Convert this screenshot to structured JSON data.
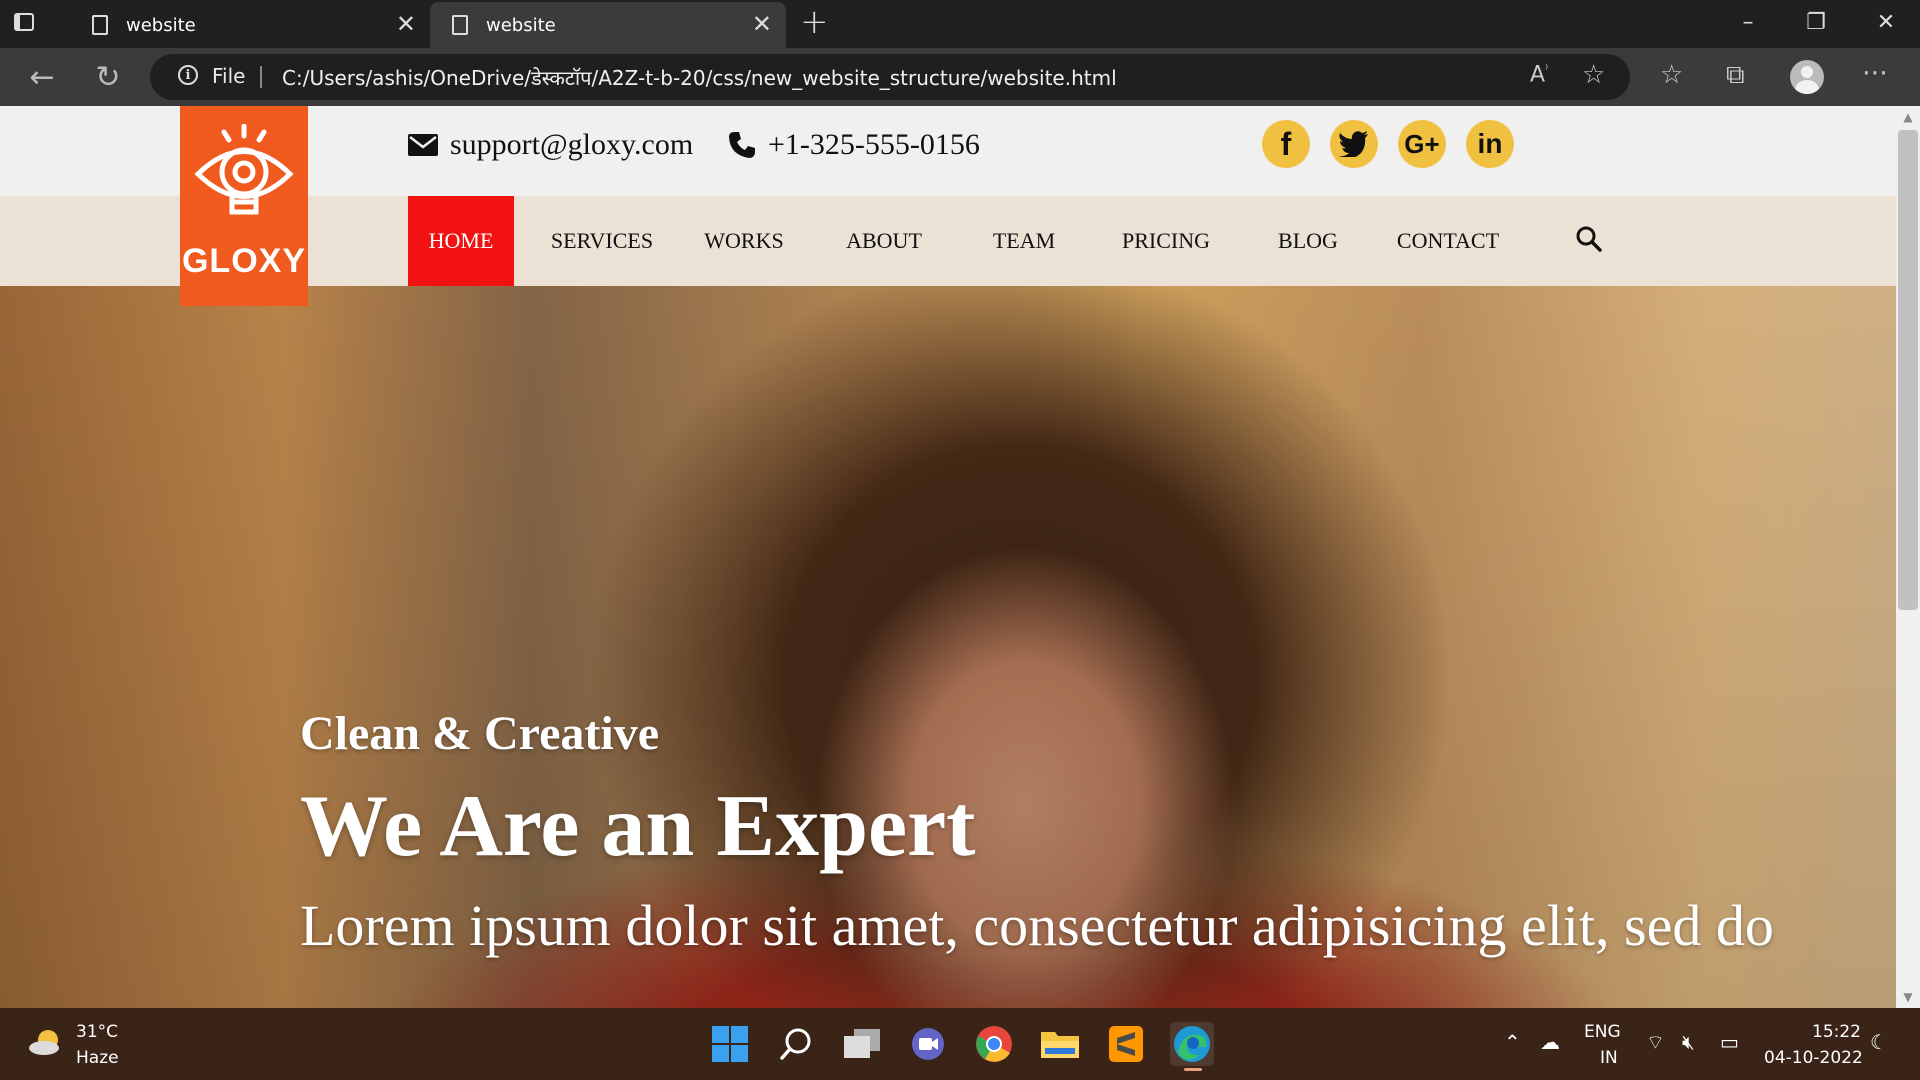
{
  "browser": {
    "tabs": [
      {
        "title": "website",
        "active": false
      },
      {
        "title": "website",
        "active": true
      }
    ],
    "scheme_label": "File",
    "url": "C:/Users/ashis/OneDrive/डेस्कटॉप/A2Z-t-b-20/css/new_website_structure/website.html"
  },
  "site": {
    "logo_text": "GLOXY",
    "email": "support@gloxy.com",
    "phone": "+1-325-555-0156",
    "social": [
      "facebook",
      "twitter",
      "google-plus",
      "linkedin"
    ],
    "social_labels": {
      "facebook": "f",
      "google_plus": "G+",
      "linkedin": "in"
    },
    "nav": [
      "HOME",
      "SERVICES",
      "WORKS",
      "ABOUT",
      "TEAM",
      "PRICING",
      "BLOG",
      "CONTACT"
    ],
    "active_nav": "HOME",
    "hero": {
      "subtitle": "Clean & Creative",
      "title": "We Are an Expert",
      "text": "Lorem ipsum dolor sit amet, consectetur adipisicing elit, sed do"
    },
    "colors": {
      "brand": "#f05a1e",
      "nav_active": "#f21212",
      "social": "#f0c040"
    }
  },
  "taskbar": {
    "weather_temp": "31°C",
    "weather_condition": "Haze",
    "lang_line1": "ENG",
    "lang_line2": "IN",
    "time": "15:22",
    "date": "04-10-2022"
  }
}
